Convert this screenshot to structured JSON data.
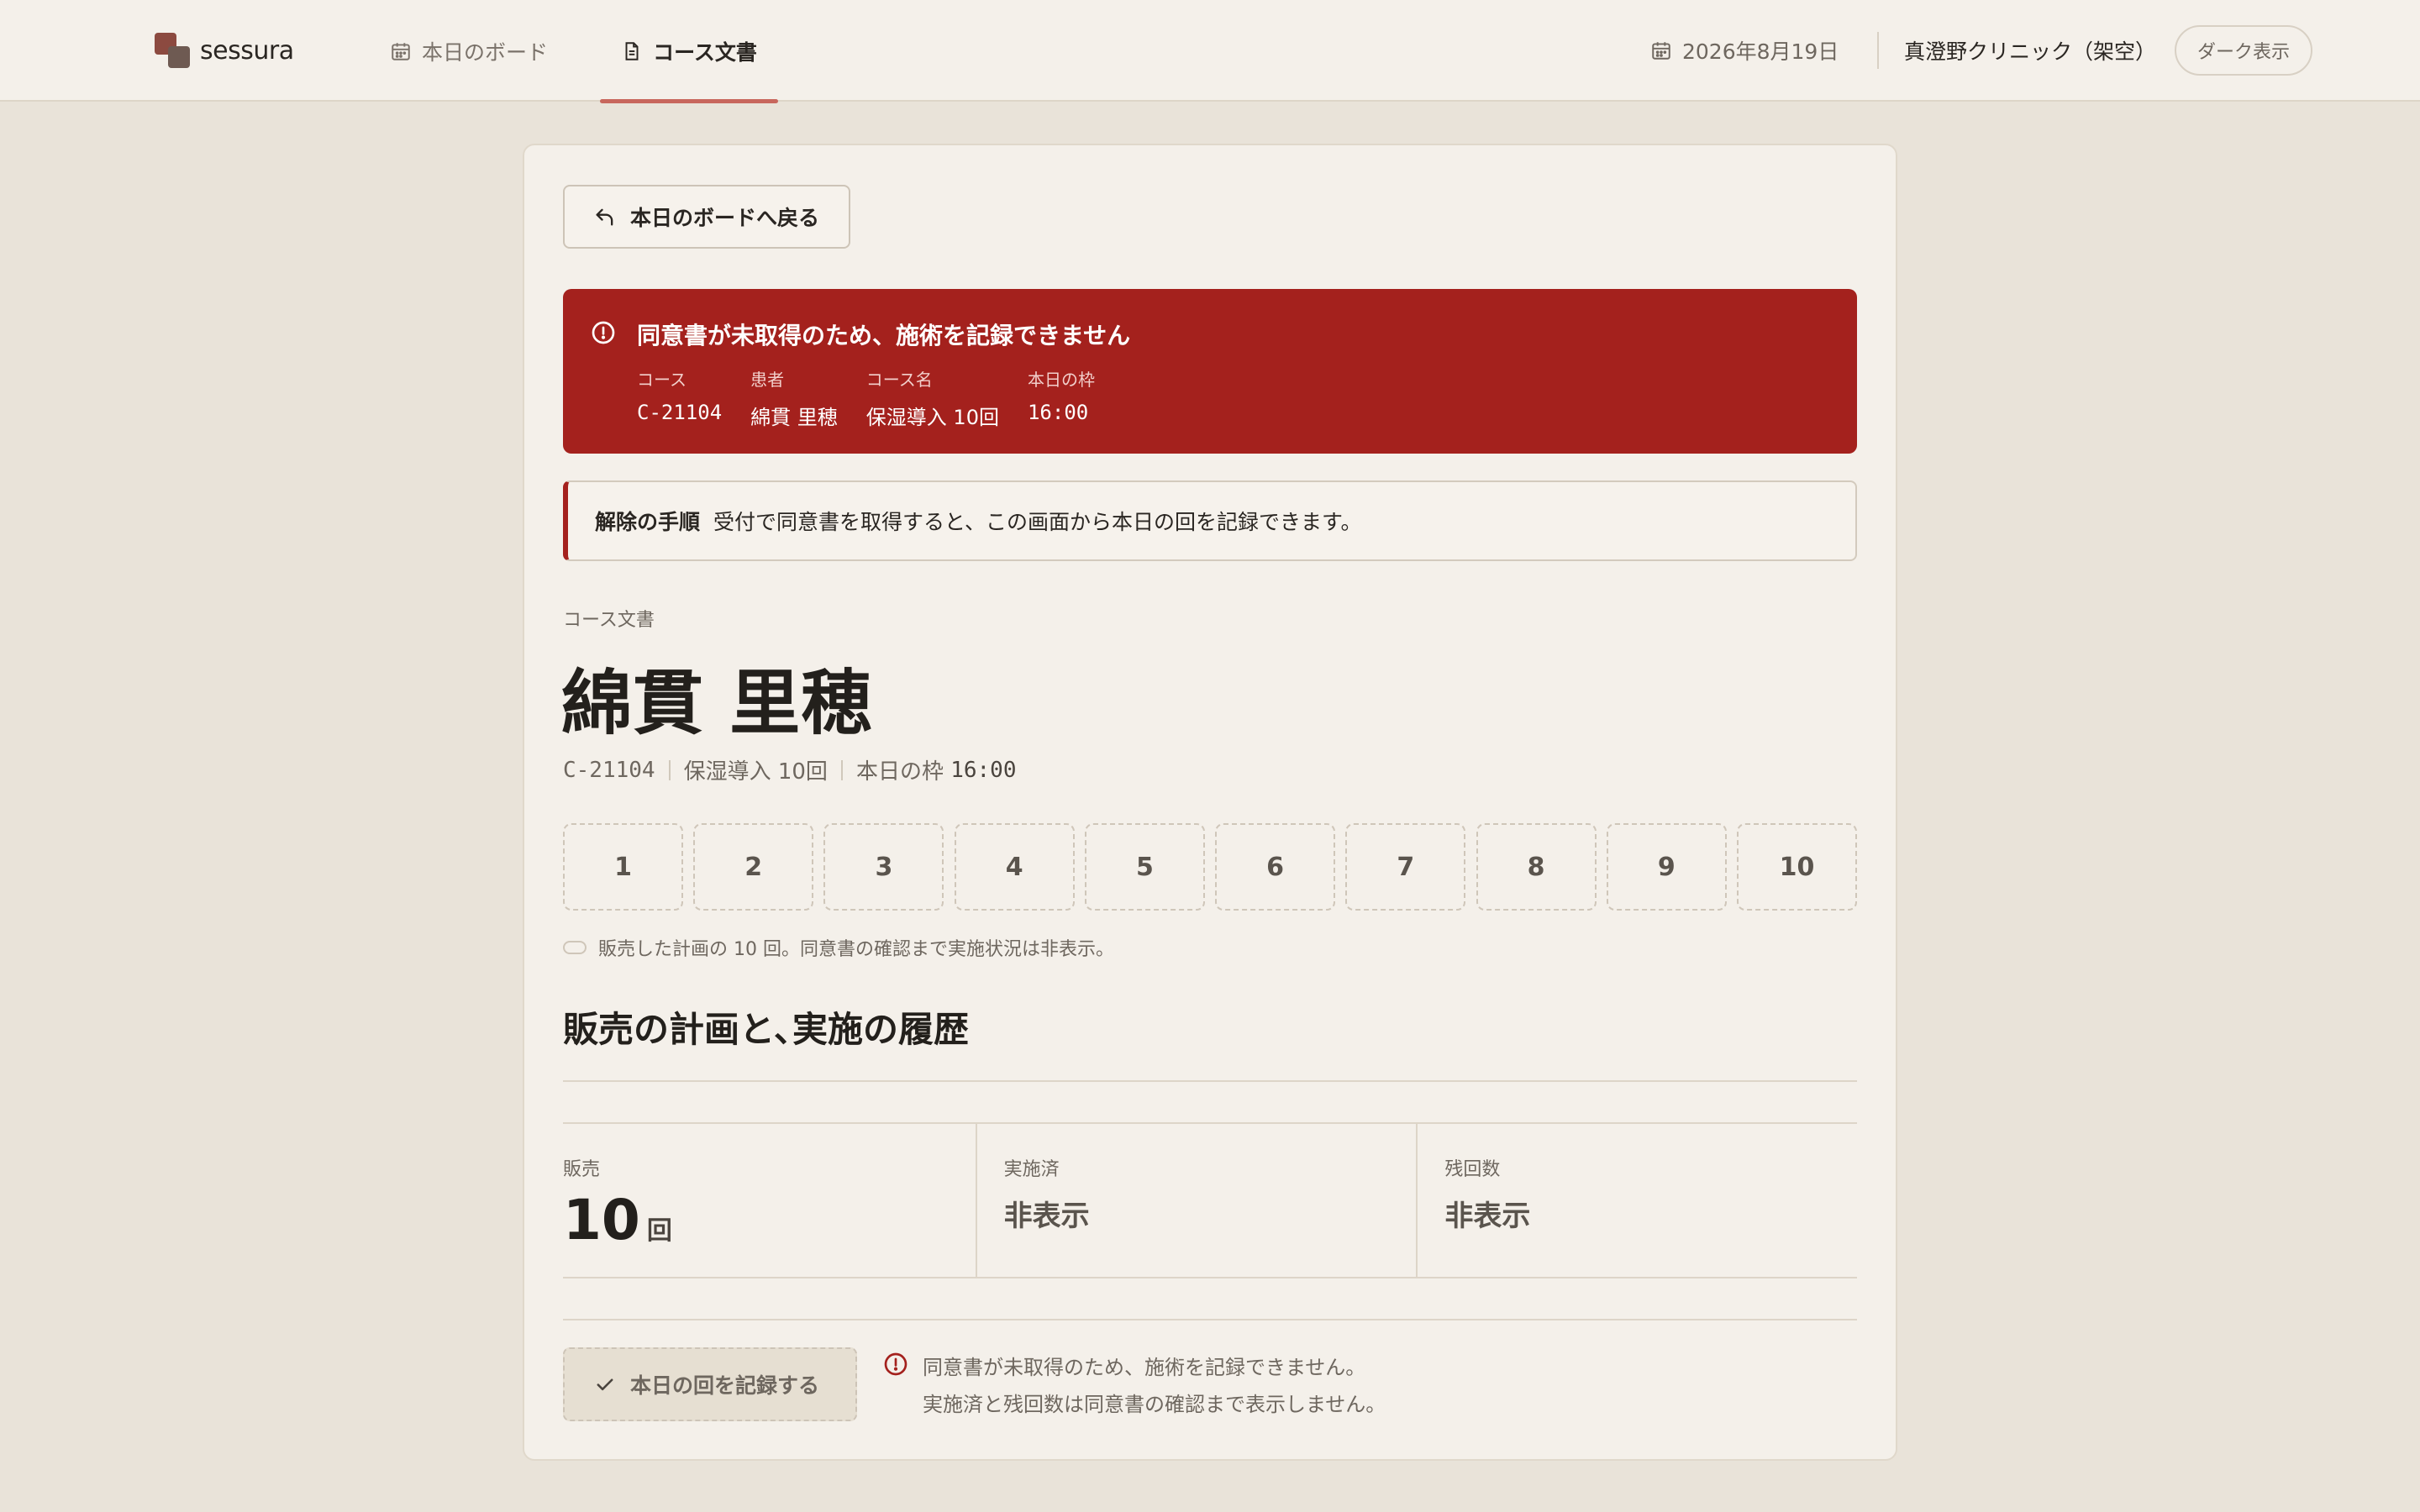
{
  "app": {
    "brand": "sessura"
  },
  "nav": {
    "tabs": [
      {
        "label": "本日のボード",
        "icon": "calendar-icon",
        "active": false
      },
      {
        "label": "コース文書",
        "icon": "document-icon",
        "active": true
      }
    ]
  },
  "header": {
    "date": "2026年8月19日",
    "clinic": "真澄野クリニック（架空）",
    "dark_mode_label": "ダーク表示"
  },
  "colors": {
    "accent": "#c8675d",
    "alert_bg": "#a4211d",
    "background": "#e9e3d9",
    "surface": "#f4f0ea"
  },
  "back_button": {
    "label": "本日のボードへ戻る"
  },
  "alert": {
    "title": "同意書が未取得のため、施術を記録できません",
    "fields": [
      {
        "label": "コース",
        "value": "C-21104"
      },
      {
        "label": "患者",
        "value": "綿貫 里穂"
      },
      {
        "label": "コース名",
        "value": "保湿導入 10回"
      },
      {
        "label": "本日の枠",
        "value": "16:00"
      }
    ]
  },
  "resolution": {
    "key": "解除の手順",
    "text": "受付で同意書を取得すると、この画面から本日の回を記録できます。"
  },
  "document": {
    "eyebrow": "コース文書",
    "patient_name": "綿貫 里穂",
    "course_id": "C-21104",
    "course_name": "保湿導入 10回",
    "slot_label": "本日の枠",
    "slot_time": "16:00"
  },
  "sessions": [
    "1",
    "2",
    "3",
    "4",
    "5",
    "6",
    "7",
    "8",
    "9",
    "10"
  ],
  "sessions_legend": "販売した計画の 10 回。同意書の確認まで実施状況は非表示。",
  "section": {
    "title": "販売の計画と､実施の履歴"
  },
  "stats": {
    "sold_label": "販売",
    "sold_value": "10",
    "sold_unit": "回",
    "done_label": "実施済",
    "done_value": "非表示",
    "remaining_label": "残回数",
    "remaining_value": "非表示"
  },
  "record": {
    "button_label": "本日の回を記録する",
    "note_line1": "同意書が未取得のため、施術を記録できません。",
    "note_line2": "実施済と残回数は同意書の確認まで表示しません。"
  }
}
